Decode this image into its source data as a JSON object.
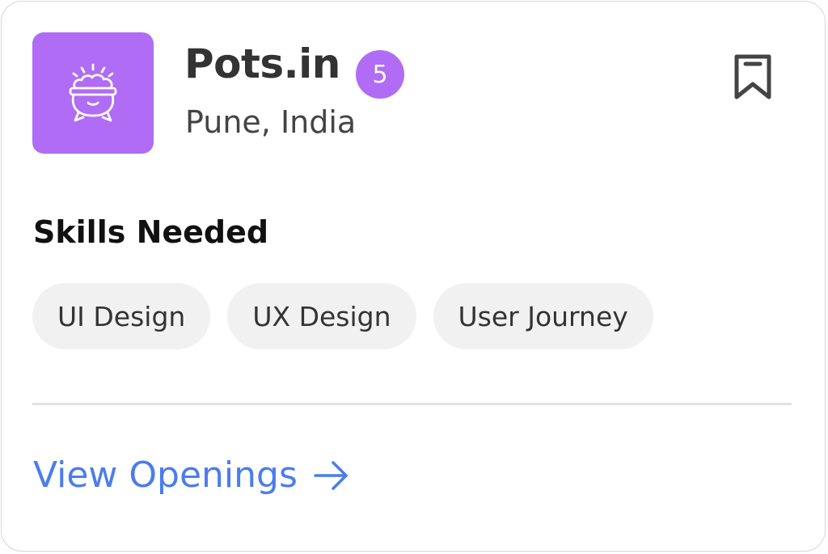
{
  "company": {
    "name": "Pots.in",
    "openings_count": "5",
    "location": "Pune, India",
    "logo_icon": "cauldron-pot-icon"
  },
  "skills": {
    "title": "Skills Needed",
    "items": [
      {
        "label": "UI Design"
      },
      {
        "label": "UX Design"
      },
      {
        "label": "User Journey"
      }
    ]
  },
  "footer": {
    "view_openings_label": "View Openings"
  },
  "colors": {
    "brand_purple": "#b06cf4",
    "link_blue": "#4a7cf0",
    "chip_bg": "#f1f1f1"
  }
}
